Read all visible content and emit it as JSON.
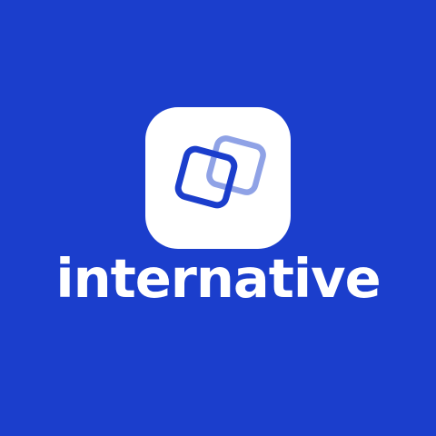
{
  "brand": {
    "name": "internative",
    "logo_icon": "overlapping-squares-icon",
    "colors": {
      "background": "#1b3ecc",
      "tile": "#ffffff",
      "front_square": "#1b3ecc",
      "back_square": "#8fa2e6",
      "wordmark": "#ffffff"
    }
  }
}
